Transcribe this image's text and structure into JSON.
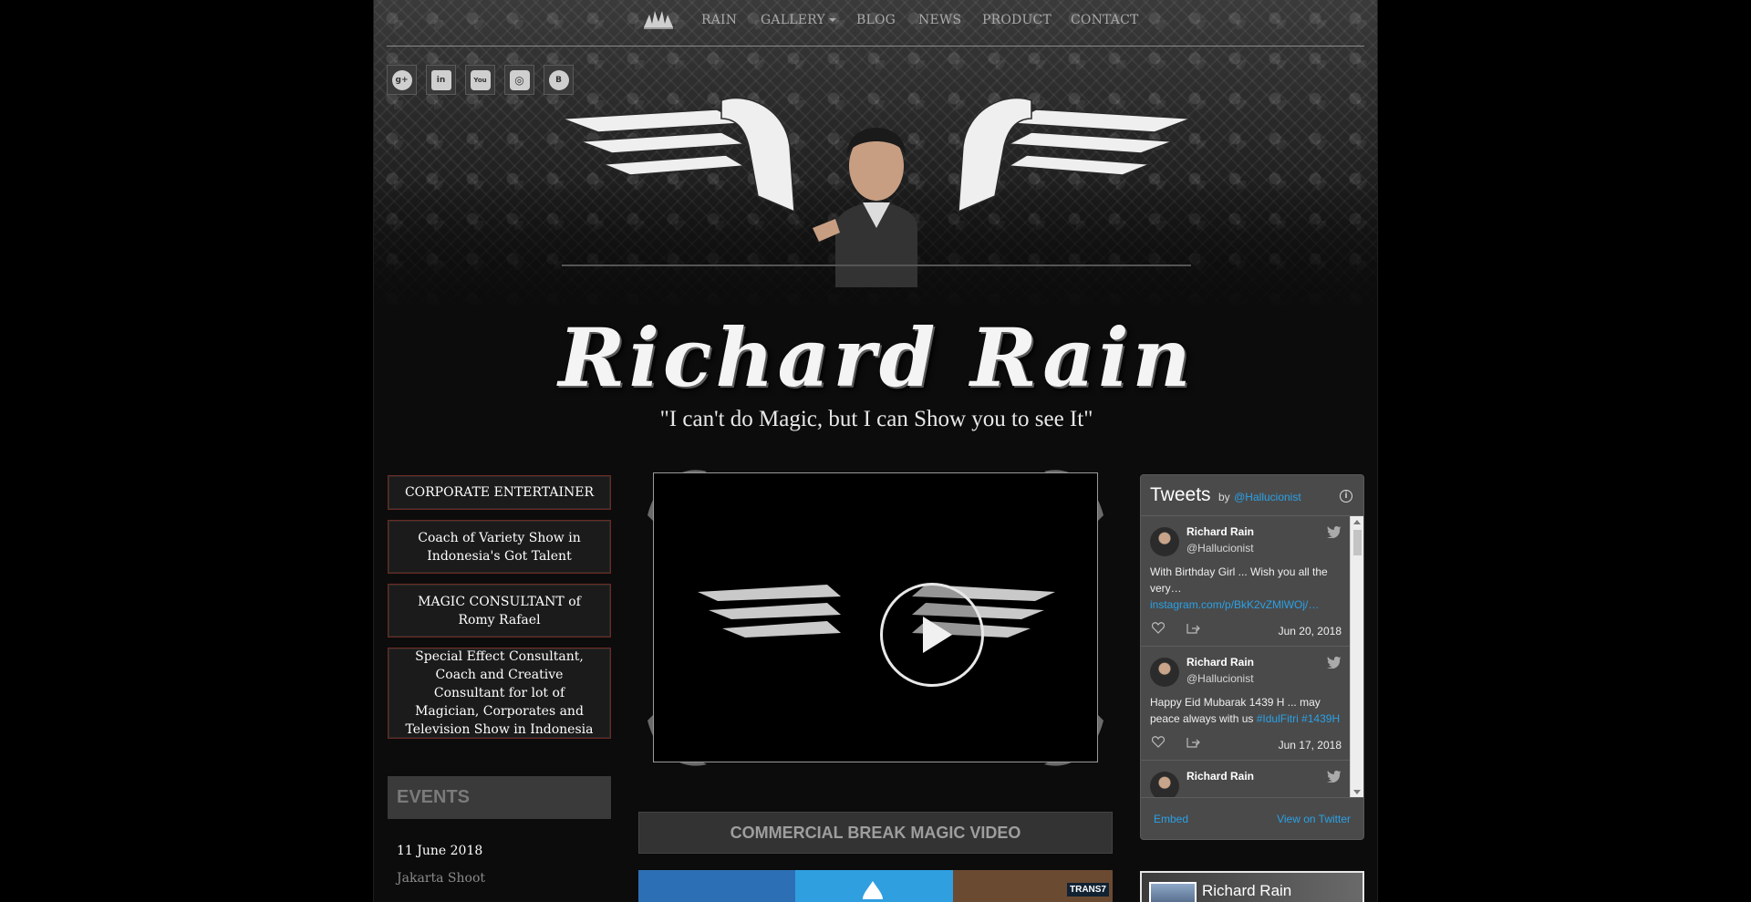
{
  "nav": {
    "items": [
      "RAIN",
      "GALLERY",
      "BLOG",
      "NEWS",
      "PRODUCT",
      "CONTACT"
    ]
  },
  "social": [
    {
      "name": "google-plus",
      "glyph": "g+"
    },
    {
      "name": "linkedin",
      "glyph": "in"
    },
    {
      "name": "youtube",
      "glyph": "You"
    },
    {
      "name": "instagram",
      "glyph": "◎"
    },
    {
      "name": "blogger",
      "glyph": "B"
    }
  ],
  "hero": {
    "title": "Richard Rain",
    "tagline": "\"I can't do Magic, but I can Show you to see It\""
  },
  "roles": [
    "CORPORATE ENTERTAINER",
    "Coach of Variety Show in Indonesia's Got Talent",
    "MAGIC CONSULTANT of Romy Rafael",
    "Special Effect Consultant, Coach and Creative Consultant for lot of Magician, Corporates and Television Show in Indonesia"
  ],
  "events": {
    "heading": "EVENTS",
    "items": [
      {
        "date": "11 June 2018",
        "title": "Jakarta Shoot"
      }
    ]
  },
  "video": {
    "section_heading": "COMMERCIAL BREAK MAGIC VIDEO",
    "thumb_badge": "TRANS7"
  },
  "twitter": {
    "title": "Tweets",
    "by": "by",
    "handle": "@Hallucionist",
    "tweets": [
      {
        "name": "Richard Rain",
        "user": "@Hallucionist",
        "text": "With Birthday Girl ... Wish you all the very…",
        "link": "instagram.com/p/BkK2vZMlWOj/…",
        "date": "Jun 20, 2018"
      },
      {
        "name": "Richard Rain",
        "user": "@Hallucionist",
        "text": "Happy Eid Mubarak 1439 H ... may peace always with us",
        "link": "#IdulFitri #1439H",
        "date": "Jun 17, 2018"
      },
      {
        "name": "Richard Rain",
        "user": "",
        "text": "",
        "link": "",
        "date": ""
      }
    ],
    "embed": "Embed",
    "view_on": "View on Twitter"
  },
  "facebook": {
    "name": "Richard Rain"
  },
  "colors": {
    "accent_border": "#6d2a22",
    "twitter_link": "#2aa1e6",
    "nav_text": "#a9a9a9"
  }
}
